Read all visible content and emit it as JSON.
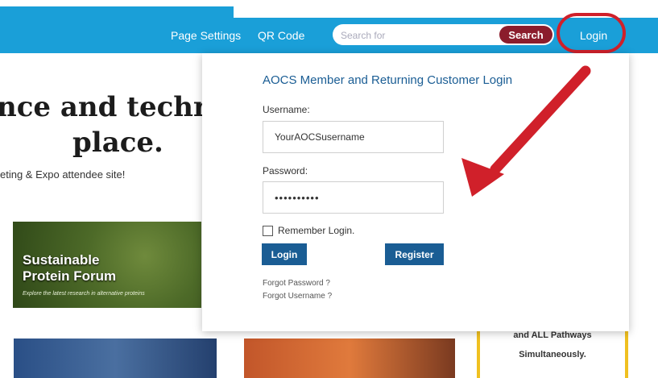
{
  "nav": {
    "page_settings": "Page Settings",
    "qr_code": "QR Code",
    "search_placeholder": "Search for",
    "search_button": "Search",
    "login_button": "Login"
  },
  "background": {
    "hero_line1": "nce and techr",
    "hero_line2": "place.",
    "hero_sub": "eting & Expo attendee site!",
    "promo_green_title": "Sustainable Protein Forum",
    "promo_green_caption": "Explore the latest research in alternative proteins",
    "promo_yellow_line1": "and ALL Pathways",
    "promo_yellow_line2": "Simultaneously."
  },
  "login_panel": {
    "title": "AOCS Member and Returning Customer Login",
    "username_label": "Username:",
    "username_value": "YourAOCSusername",
    "password_label": "Password:",
    "password_value": "••••••••••",
    "remember_label": "Remember Login.",
    "login_button": "Login",
    "register_button": "Register",
    "forgot_password": "Forgot Password ?",
    "forgot_username": "Forgot Username ?"
  },
  "colors": {
    "nav_blue": "#1a9fd8",
    "search_red": "#8b1c2c",
    "panel_blue": "#1a5d94",
    "annotation_red": "#d0202a"
  }
}
